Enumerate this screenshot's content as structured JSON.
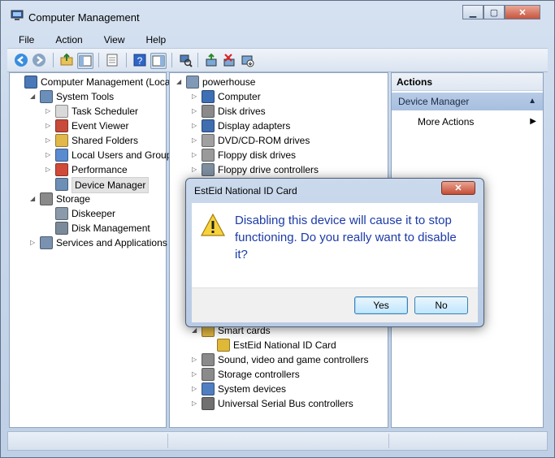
{
  "window": {
    "title": "Computer Management"
  },
  "menu": [
    "File",
    "Action",
    "View",
    "Help"
  ],
  "left_tree": [
    {
      "label": "Computer Management (Local",
      "indent": 0,
      "expander": "",
      "icon": "computer-management-icon",
      "selected": false
    },
    {
      "label": "System Tools",
      "indent": 1,
      "expander": "◢",
      "icon": "system-tools-icon",
      "selected": false
    },
    {
      "label": "Task Scheduler",
      "indent": 2,
      "expander": "▷",
      "icon": "clock-icon",
      "selected": false
    },
    {
      "label": "Event Viewer",
      "indent": 2,
      "expander": "▷",
      "icon": "event-viewer-icon",
      "selected": false
    },
    {
      "label": "Shared Folders",
      "indent": 2,
      "expander": "▷",
      "icon": "shared-folder-icon",
      "selected": false
    },
    {
      "label": "Local Users and Groups",
      "indent": 2,
      "expander": "▷",
      "icon": "users-icon",
      "selected": false
    },
    {
      "label": "Performance",
      "indent": 2,
      "expander": "▷",
      "icon": "performance-icon",
      "selected": false
    },
    {
      "label": "Device Manager",
      "indent": 2,
      "expander": "",
      "icon": "device-manager-icon",
      "selected": true
    },
    {
      "label": "Storage",
      "indent": 1,
      "expander": "◢",
      "icon": "storage-icon",
      "selected": false
    },
    {
      "label": "Diskeeper",
      "indent": 2,
      "expander": "",
      "icon": "diskeeper-icon",
      "selected": false
    },
    {
      "label": "Disk Management",
      "indent": 2,
      "expander": "",
      "icon": "disk-management-icon",
      "selected": false
    },
    {
      "label": "Services and Applications",
      "indent": 1,
      "expander": "▷",
      "icon": "services-icon",
      "selected": false
    }
  ],
  "device_tree_top": [
    {
      "label": "powerhouse",
      "indent": 0,
      "expander": "◢",
      "icon": "computer-icon"
    },
    {
      "label": "Computer",
      "indent": 1,
      "expander": "▷",
      "icon": "monitor-icon"
    },
    {
      "label": "Disk drives",
      "indent": 1,
      "expander": "▷",
      "icon": "disk-drive-icon"
    },
    {
      "label": "Display adapters",
      "indent": 1,
      "expander": "▷",
      "icon": "display-adapter-icon"
    },
    {
      "label": "DVD/CD-ROM drives",
      "indent": 1,
      "expander": "▷",
      "icon": "dvd-icon"
    },
    {
      "label": "Floppy disk drives",
      "indent": 1,
      "expander": "▷",
      "icon": "floppy-icon"
    },
    {
      "label": "Floppy drive controllers",
      "indent": 1,
      "expander": "▷",
      "icon": "floppy-controller-icon"
    }
  ],
  "device_tree_bottom": [
    {
      "label": "Smart cards",
      "indent": 1,
      "expander": "◢",
      "icon": "smart-card-icon"
    },
    {
      "label": "EstEid National ID Card",
      "indent": 2,
      "expander": "",
      "icon": "id-card-icon"
    },
    {
      "label": "Sound, video and game controllers",
      "indent": 1,
      "expander": "▷",
      "icon": "sound-icon"
    },
    {
      "label": "Storage controllers",
      "indent": 1,
      "expander": "▷",
      "icon": "storage-controller-icon"
    },
    {
      "label": "System devices",
      "indent": 1,
      "expander": "▷",
      "icon": "system-devices-icon"
    },
    {
      "label": "Universal Serial Bus controllers",
      "indent": 1,
      "expander": "▷",
      "icon": "usb-icon"
    }
  ],
  "actions": {
    "header": "Actions",
    "section": "Device Manager",
    "item": "More Actions"
  },
  "dialog": {
    "title": "EstEid National ID Card",
    "message": "Disabling this device will cause it to stop functioning. Do you really want to disable it?",
    "yes_label": "Yes",
    "no_label": "No"
  }
}
